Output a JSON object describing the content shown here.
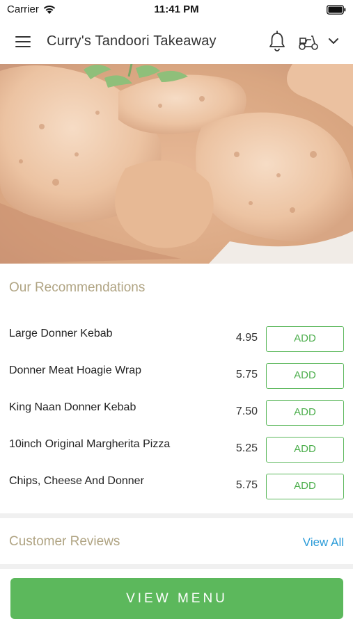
{
  "status_bar": {
    "carrier": "Carrier",
    "time": "11:41 PM",
    "icons": [
      "wifi-icon",
      "battery-icon"
    ]
  },
  "app_bar": {
    "title": "Curry's Tandoori Takeaway",
    "icons": [
      "hamburger-menu-icon",
      "bell-icon",
      "scooter-delivery-icon",
      "chevron-down-icon"
    ]
  },
  "hero": {
    "image": "chicken curry photo"
  },
  "recommendations": {
    "title": "Our Recommendations",
    "items": [
      {
        "name": "Large Donner Kebab",
        "price": "4.95",
        "button": "ADD"
      },
      {
        "name": "Donner Meat Hoagie Wrap",
        "price": "5.75",
        "button": "ADD"
      },
      {
        "name": "King Naan Donner Kebab",
        "price": "7.50",
        "button": "ADD"
      },
      {
        "name": "10inch Original Margherita Pizza",
        "price": "5.25",
        "button": "ADD"
      },
      {
        "name": "Chips, Cheese And Donner",
        "price": "5.75",
        "button": "ADD"
      }
    ]
  },
  "reviews": {
    "title": "Customer Reviews",
    "view_all": "View All"
  },
  "footer": {
    "view_menu": "VIEW MENU"
  },
  "colors": {
    "accent_green": "#5cb85c",
    "link_blue": "#2a9bd8",
    "section_title": "#b0a483"
  }
}
